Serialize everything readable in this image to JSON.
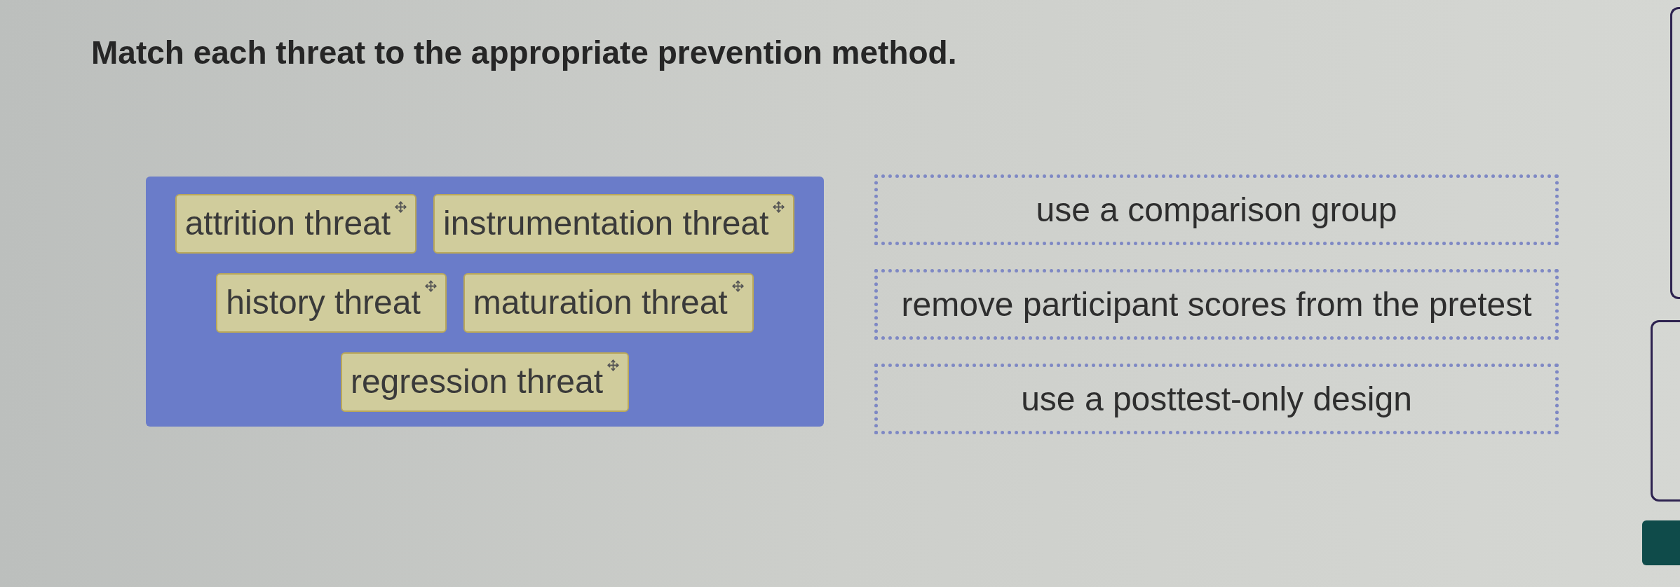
{
  "prompt": "Match each threat to the appropriate prevention method.",
  "threats": [
    {
      "label": "attrition threat"
    },
    {
      "label": "instrumentation threat"
    },
    {
      "label": "history threat"
    },
    {
      "label": "maturation threat"
    },
    {
      "label": "regression threat"
    }
  ],
  "methods": [
    {
      "label": "use a comparison group"
    },
    {
      "label": "remove participant scores from the pretest"
    },
    {
      "label": "use a posttest-only design"
    }
  ]
}
